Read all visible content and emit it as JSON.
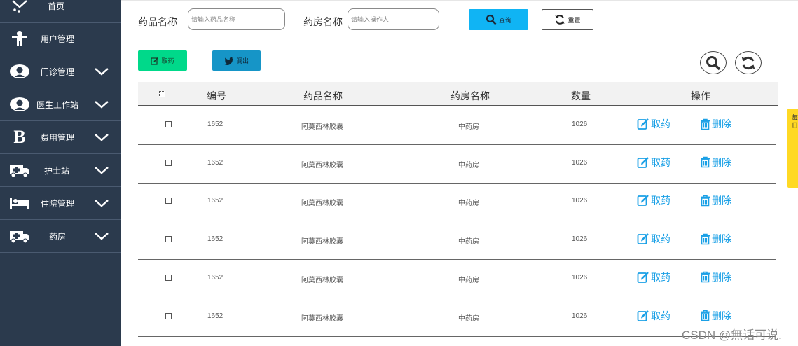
{
  "sidebar": {
    "items": [
      {
        "label": "首页",
        "icon": "home-icon",
        "has_chevron": false
      },
      {
        "label": "用户管理",
        "icon": "user-figure-icon",
        "has_chevron": false
      },
      {
        "label": "门诊管理",
        "icon": "outpatient-icon",
        "has_chevron": true
      },
      {
        "label": "医生工作站",
        "icon": "doctor-icon",
        "has_chevron": true
      },
      {
        "label": "费用管理",
        "icon": "bold-b-icon",
        "has_chevron": true
      },
      {
        "label": "护士站",
        "icon": "ambulance-icon",
        "has_chevron": true
      },
      {
        "label": "住院管理",
        "icon": "bed-icon",
        "has_chevron": true
      },
      {
        "label": "药房",
        "icon": "ambulance-icon",
        "has_chevron": true
      }
    ]
  },
  "search": {
    "drug_name_label": "药品名称",
    "drug_name_placeholder": "请输入药品名称",
    "pharmacy_name_label": "药房名称",
    "pharmacy_name_placeholder": "请输入操作人",
    "query_label": "查询",
    "reset_label": "重置"
  },
  "toolbar": {
    "fetch_label": "取药",
    "transfer_label": "调出"
  },
  "colors": {
    "sidebar_bg": "#2b3a4d",
    "query_bg": "#10b4f4",
    "fetch_bg": "#00d98a",
    "transfer_bg": "#1695c7",
    "action_link": "#1aa0e6"
  },
  "table": {
    "headers": {
      "id": "编号",
      "drug_name": "药品名称",
      "pharmacy": "药房名称",
      "quantity": "数量",
      "actions": "操作"
    },
    "rows": [
      {
        "id": "1652",
        "drug_name": "阿莫西林胶囊",
        "pharmacy": "中药房",
        "quantity": "1026"
      },
      {
        "id": "1652",
        "drug_name": "阿莫西林胶囊",
        "pharmacy": "中药房",
        "quantity": "1026"
      },
      {
        "id": "1652",
        "drug_name": "阿莫西林胶囊",
        "pharmacy": "中药房",
        "quantity": "1026"
      },
      {
        "id": "1652",
        "drug_name": "阿莫西林胶囊",
        "pharmacy": "中药房",
        "quantity": "1026"
      },
      {
        "id": "1652",
        "drug_name": "阿莫西林胶囊",
        "pharmacy": "中药房",
        "quantity": "1026"
      },
      {
        "id": "1652",
        "drug_name": "阿莫西林胶囊",
        "pharmacy": "中药房",
        "quantity": "1026"
      }
    ],
    "action_fetch": "取药",
    "action_delete": "删除"
  },
  "side_tab": {
    "label": "每日"
  },
  "watermark": "CSDN @無话可说."
}
